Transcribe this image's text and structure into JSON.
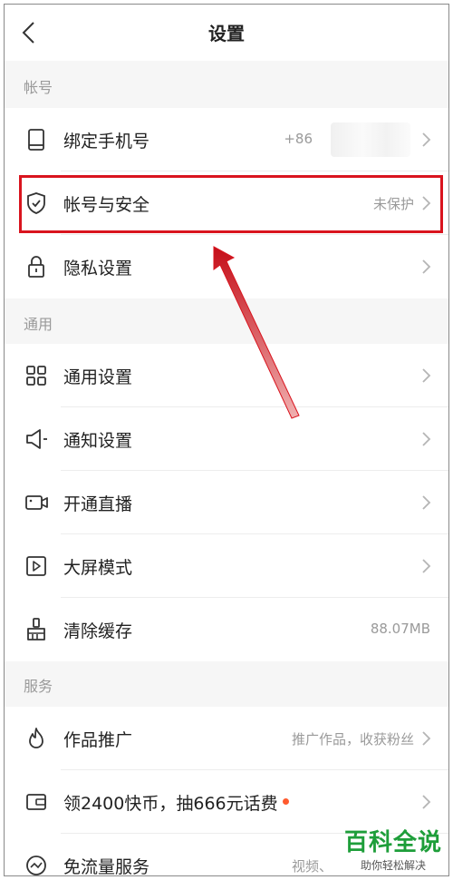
{
  "header": {
    "title": "设置",
    "back_icon": "back-arrow-icon"
  },
  "sections": {
    "account": "帐号",
    "general": "通用",
    "services": "服务"
  },
  "rows": {
    "phone": {
      "label": "绑定手机号",
      "value": "+86",
      "icon": "phone-icon"
    },
    "security": {
      "label": "帐号与安全",
      "value": "未保护",
      "icon": "shield-icon"
    },
    "privacy": {
      "label": "隐私设置",
      "icon": "lock-icon"
    },
    "general": {
      "label": "通用设置",
      "icon": "grid-icon"
    },
    "notify": {
      "label": "通知设置",
      "icon": "speaker-icon"
    },
    "live": {
      "label": "开通直播",
      "icon": "camera-icon"
    },
    "bigscreen": {
      "label": "大屏模式",
      "icon": "play-square-icon"
    },
    "cache": {
      "label": "清除缓存",
      "value": "88.07MB",
      "icon": "broom-icon"
    },
    "promote": {
      "label": "作品推广",
      "value": "推广作品，收获粉丝",
      "icon": "flame-icon"
    },
    "coins": {
      "label": "领2400快币，抽666元话费",
      "icon": "wallet-icon"
    },
    "traffic": {
      "label": "免流量服务",
      "value": "视频、",
      "icon": "traffic-icon"
    }
  },
  "watermark": {
    "title": "百科全说",
    "subtitle": "助你轻松解决"
  },
  "colors": {
    "highlight": "#d9141e",
    "dot": "#ff5a2e",
    "watermark": "#1e9e3a"
  }
}
